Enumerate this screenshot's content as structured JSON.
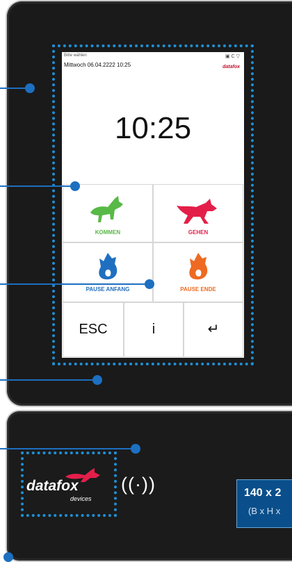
{
  "status": {
    "hint": "Bitte wählen",
    "date_time": "Mittwoch 06.04.2222 10:25",
    "icons": "▣ C ▽",
    "brand": "datafox"
  },
  "clock": {
    "time": "10:25"
  },
  "buttons": {
    "kommen": "KOMMEN",
    "gehen": "GEHEN",
    "pause_anfang": "PAUSE ANFANG",
    "pause_ende": "PAUSE ENDE"
  },
  "keys": {
    "esc": "ESC",
    "info": "i",
    "enter": "↵"
  },
  "logo": {
    "name": "datafox",
    "sub": "devices"
  },
  "nfc": {
    "symbol": "((·))"
  },
  "dimensions": {
    "size": "140 x 2",
    "note": "(B x H x"
  },
  "colors": {
    "accent_blue": "#1e90d6",
    "kommen_green": "#58b947",
    "gehen_red": "#e31f49",
    "pause_blue": "#1f6fc0",
    "pause_orange": "#ee6a22"
  }
}
